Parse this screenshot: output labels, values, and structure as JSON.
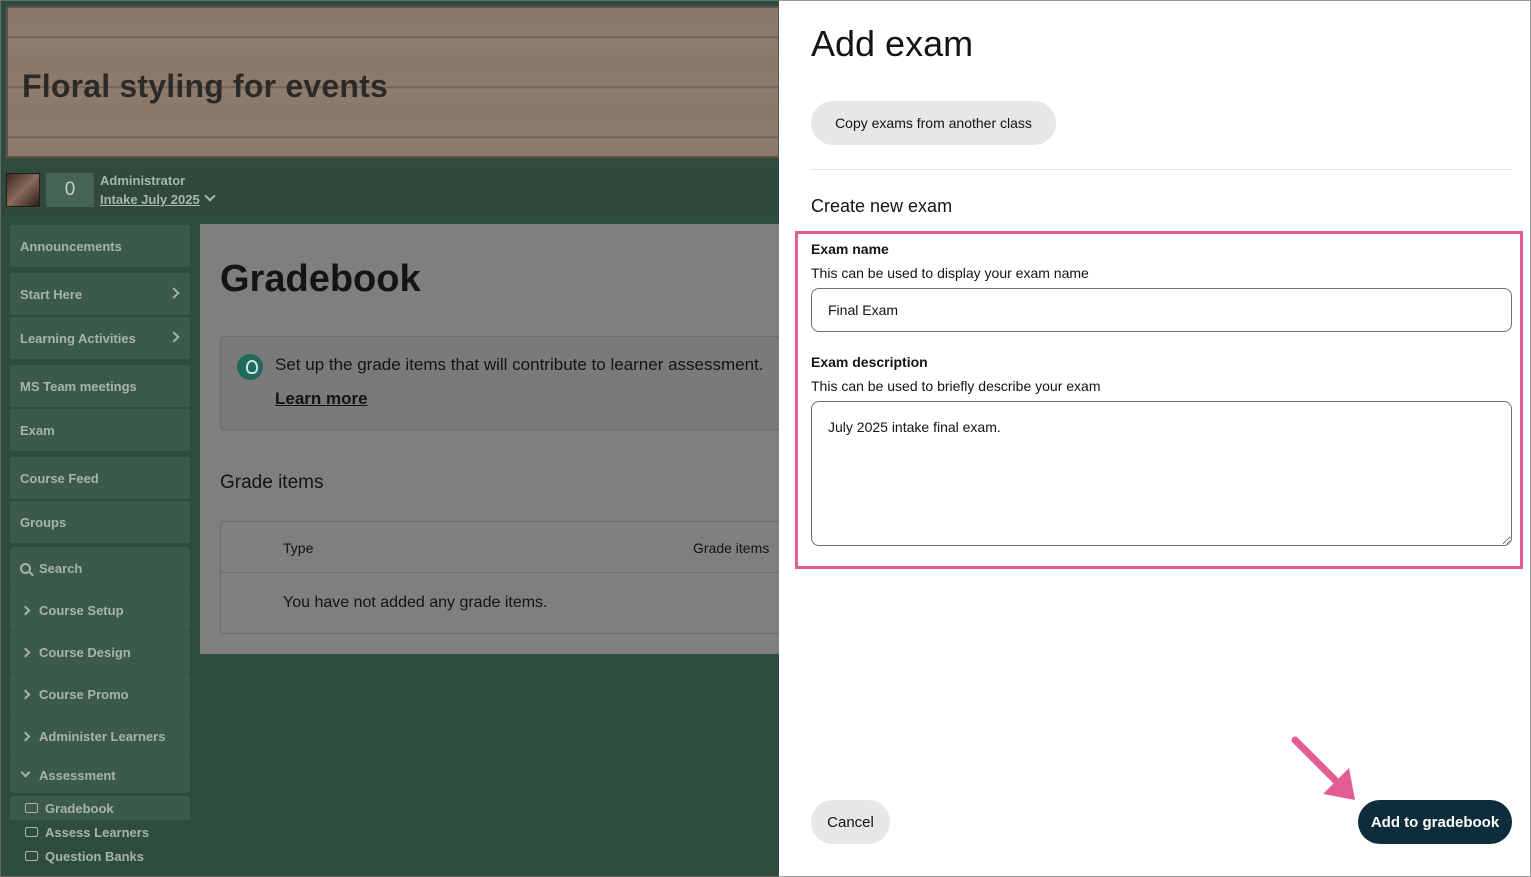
{
  "course": {
    "title": "Floral styling for events",
    "notification_count": "0",
    "role": "Administrator",
    "intake": "Intake July 2025"
  },
  "sidebar": {
    "items": [
      {
        "label": "Announcements"
      },
      {
        "label": "Start Here"
      },
      {
        "label": "Learning Activities"
      },
      {
        "label": "MS Team meetings"
      },
      {
        "label": "Exam"
      },
      {
        "label": "Course Feed"
      },
      {
        "label": "Groups"
      },
      {
        "label": "Search"
      },
      {
        "label": "Course Setup"
      },
      {
        "label": "Course Design"
      },
      {
        "label": "Course Promo"
      },
      {
        "label": "Administer Learners"
      },
      {
        "label": "Assessment"
      }
    ],
    "assessment_subitems": [
      {
        "label": "Gradebook"
      },
      {
        "label": "Assess Learners"
      },
      {
        "label": "Question Banks"
      }
    ]
  },
  "gradebook": {
    "title": "Gradebook",
    "tip_text": "Set up the grade items that will contribute to learner assessment.",
    "tip_link": "Learn more",
    "grade_items_title": "Grade items",
    "columns": [
      "Type",
      "Grade items"
    ],
    "empty_text": "You have not added any grade items."
  },
  "drawer": {
    "title": "Add exam",
    "copy_button": "Copy exams from another class",
    "section_title": "Create new exam",
    "exam_name_label": "Exam name",
    "exam_name_hint": "This can be used to display your exam name",
    "exam_name_value": "Final Exam",
    "exam_desc_label": "Exam description",
    "exam_desc_hint": "This can be used to briefly describe your exam",
    "exam_desc_value": "July 2025 intake final exam.",
    "cancel_button": "Cancel",
    "add_button": "Add to gradebook"
  },
  "colors": {
    "highlight": "#e25d93",
    "primary_button": "#0d2c3c",
    "overlay_green": "#2f4d3c"
  }
}
